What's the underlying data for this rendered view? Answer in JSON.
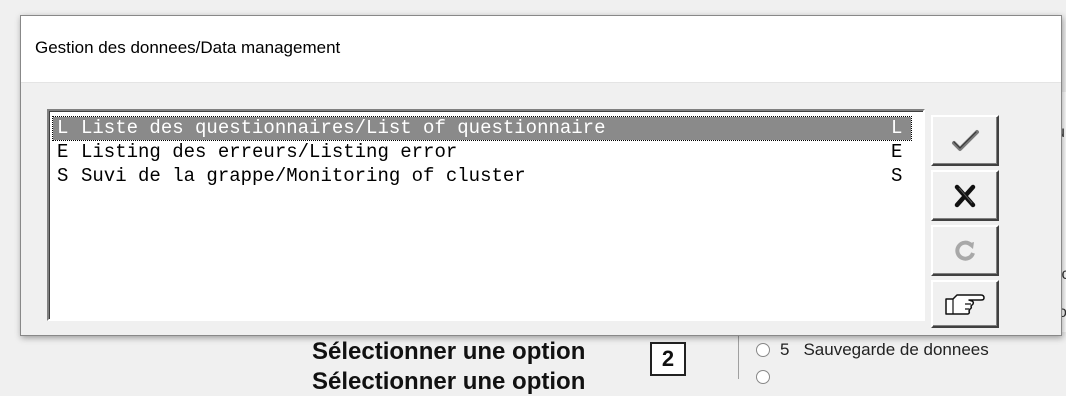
{
  "dialog": {
    "title": "Gestion des donnees/Data management",
    "list_items": [
      {
        "key": "L",
        "label": "Liste des questionnaires/List of questionnaire",
        "shortcut": "L",
        "selected": true
      },
      {
        "key": "E",
        "label": "Listing des erreurs/Listing error",
        "shortcut": "E",
        "selected": false
      },
      {
        "key": "S",
        "label": "Suvi de la grappe/Monitoring of cluster",
        "shortcut": "S",
        "selected": false
      }
    ],
    "buttons": {
      "ok_icon": "checkmark-icon",
      "cancel_icon": "cross-icon",
      "refresh_icon": "refresh-icon",
      "pointer_icon": "pointing-hand-icon"
    }
  },
  "background": {
    "select_option_label": "Sélectionner une option",
    "select_option_value": "2",
    "radio_option": {
      "number": "5",
      "label": "Sauvegarde de donnees"
    },
    "clipped_texts": [
      "u",
      "ic",
      "o"
    ],
    "select_option_label_2": "Sélectionner une option"
  },
  "colors": {
    "selection_background": "#8a8a8a",
    "window_background": "#f0f0f0",
    "title_bar": "#ffffff"
  }
}
